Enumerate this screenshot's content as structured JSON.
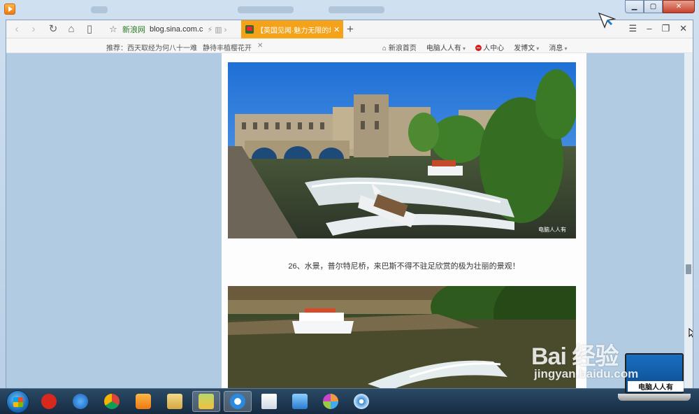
{
  "browser": {
    "address": {
      "site_label": "新浪网",
      "url": "blog.sina.com.c",
      "extra": "⚡ ▥ ›"
    },
    "active_tab": {
      "title": "【英国见闻·魅力无限的城市",
      "close": "✕"
    },
    "new_tab": "+",
    "window_controls": {
      "menu": "☰",
      "minimize": "–",
      "restore": "❐",
      "close": "✕"
    }
  },
  "toolbar": {
    "recommend_prefix": "推荐：",
    "recommend_items": [
      "西天取经为何八十一难",
      "静待丰植樱花开"
    ],
    "recommend_close": "✕",
    "menu": [
      {
        "label": "新浪首页",
        "icon": "home-icon"
      },
      {
        "label": "电脑人人有",
        "caret": true
      },
      {
        "label": "人中心",
        "icon": "red-dot-icon"
      },
      {
        "label": "发博文",
        "caret": true
      },
      {
        "label": "消息",
        "caret": true
      }
    ]
  },
  "article": {
    "caption": "26、水景，普尔特尼桥，来巴斯不得不驻足欣赏的极为壮丽的景观！",
    "photo_watermark": "电脑人人有"
  },
  "overlay": {
    "laptop_text": "电脑人人有",
    "baidu_logo": "Bai  经验",
    "baidu_domain": "jingyan.baidu.com"
  },
  "colors": {
    "tab_active": "#f4a21a",
    "page_bg": "#b0cbe2"
  }
}
